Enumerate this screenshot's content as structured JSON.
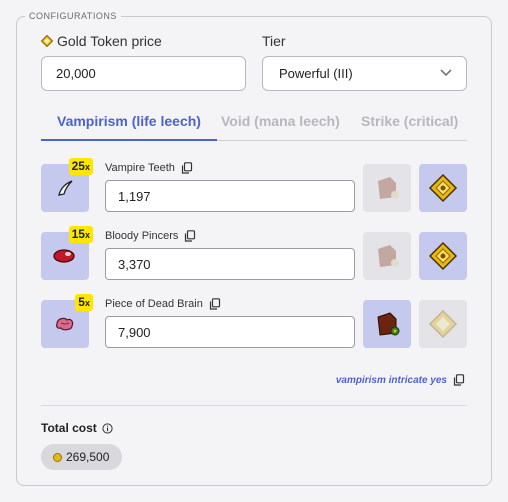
{
  "section": {
    "legend": "CONFIGURATIONS"
  },
  "gold_token": {
    "label": "Gold Token price",
    "value": "20,000"
  },
  "tier": {
    "label": "Tier",
    "selected": "Powerful (III)"
  },
  "tabs": [
    {
      "label": "Vampirism (life leech)",
      "active": true
    },
    {
      "label": "Void (mana leech)",
      "active": false
    },
    {
      "label": "Strike (critical)",
      "active": false
    }
  ],
  "items": [
    {
      "name": "Vampire Teeth",
      "quantity": "25",
      "quantity_suffix": "x",
      "price": "1,197",
      "icon": "vampire-teeth-icon"
    },
    {
      "name": "Bloody Pincers",
      "quantity": "15",
      "quantity_suffix": "x",
      "price": "3,370",
      "icon": "bloody-pincers-icon"
    },
    {
      "name": "Piece of Dead Brain",
      "quantity": "5",
      "quantity_suffix": "x",
      "price": "7,900",
      "icon": "dead-brain-icon"
    }
  ],
  "summary_text": "vampirism intricate yes",
  "total": {
    "label": "Total cost",
    "value": "269,500"
  },
  "colors": {
    "accent": "#4d63c9",
    "item_bg": "#c6c9ee",
    "badge": "#ffe600",
    "gold": "#e8b810"
  }
}
